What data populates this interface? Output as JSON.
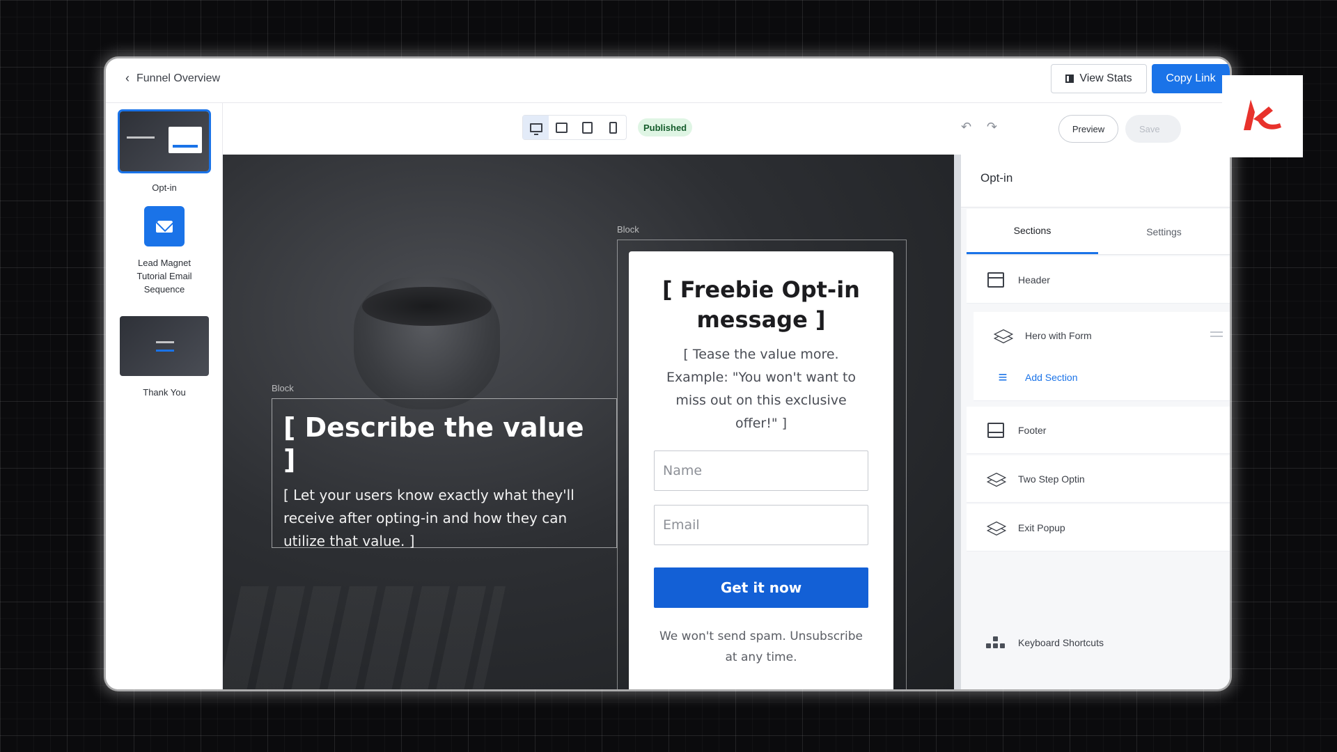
{
  "header": {
    "back_label": "Funnel Overview",
    "view_stats_label": "View Stats",
    "copy_link_label": "Copy Link"
  },
  "funnel_steps": [
    {
      "label": "Opt-in",
      "selected": true
    },
    {
      "label": "Lead Magnet Tutorial Email Sequence",
      "icon": "envelope-icon"
    },
    {
      "label": "Thank You"
    }
  ],
  "toolbar": {
    "devices": [
      "desktop",
      "laptop",
      "tablet",
      "phone"
    ],
    "active_device": "desktop",
    "status_badge": "Published",
    "preview_label": "Preview",
    "save_label": "Save"
  },
  "canvas": {
    "block_label": "Block",
    "hero_heading": "[ Describe the value ]",
    "hero_body": "[ Let your users know exactly what they'll receive after opting-in and how they can utilize that value. ]",
    "form": {
      "heading": "[ Freebie Opt-in message ]",
      "tease": "[ Tease the value more. Example: \"You won't want to miss out on this exclusive offer!\" ]",
      "name_placeholder": "Name",
      "email_placeholder": "Email",
      "submit_label": "Get it now",
      "fineprint": "We won't send spam. Unsubscribe at any time."
    }
  },
  "right_panel": {
    "title": "Opt-in",
    "tabs": [
      "Sections",
      "Settings"
    ],
    "active_tab": "Sections",
    "sections": [
      {
        "label": "Header",
        "icon": "header-block-icon"
      },
      {
        "label": "Hero with Form",
        "icon": "layers-icon"
      },
      {
        "label": "Add Section",
        "icon": "add-section-icon"
      },
      {
        "label": "Footer",
        "icon": "footer-block-icon"
      },
      {
        "label": "Two Step Optin",
        "icon": "layers-icon"
      },
      {
        "label": "Exit Popup",
        "icon": "layers-icon"
      }
    ],
    "keyboard_shortcuts_label": "Keyboard Shortcuts"
  },
  "colors": {
    "accent": "#1a73e8",
    "cta": "#1360d6",
    "badge_bg": "#dff5e4",
    "badge_text": "#145c2b",
    "brand": "#e8322c"
  }
}
